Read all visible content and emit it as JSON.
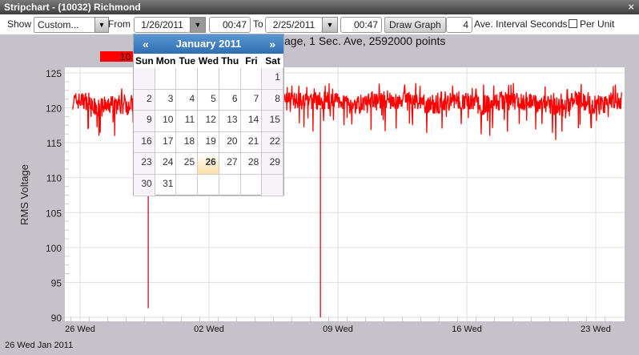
{
  "window": {
    "title": "Stripchart - (10032) Richmond",
    "close": "×"
  },
  "toolbar": {
    "show_label": "Show",
    "show_value": "Custom...",
    "from_label": "From",
    "from_date": "1/26/2011",
    "from_time": "00:47",
    "to_label": "To",
    "to_date": "2/25/2011",
    "to_time": "00:47",
    "draw_button": "Draw Graph",
    "interval_value": "4",
    "interval_label": "Ave. Interval Seconds",
    "per_unit_label": "Per Unit",
    "per_unit_checked": false
  },
  "calendar": {
    "prev": "«",
    "next": "»",
    "month": "January 2011",
    "days_of_week": [
      "Sun",
      "Mon",
      "Tue",
      "Wed",
      "Thu",
      "Fri",
      "Sat"
    ],
    "first_weekday": 6,
    "days_in_month": 31,
    "selected_day": 26
  },
  "chart_data": {
    "type": "line",
    "title": "age, 1 Sec. Ave, 2592000 points",
    "legend": [
      {
        "label": "10",
        "color": "#ff0000"
      }
    ],
    "ylabel": "RMS Voltage",
    "ylim": [
      90,
      126
    ],
    "yticks": [
      90,
      95,
      100,
      105,
      110,
      115,
      120,
      125
    ],
    "xlabel": "26 Wed Jan 2011",
    "xunit": "days since 26 Jan 2011",
    "xlim": [
      -0.8,
      29.6
    ],
    "xticks": [
      {
        "x": 0,
        "label": "26 Wed"
      },
      {
        "x": 7,
        "label": "02 Wed"
      },
      {
        "x": 14,
        "label": "09 Wed"
      },
      {
        "x": 21,
        "label": "16 Wed"
      },
      {
        "x": 28,
        "label": "23 Wed"
      }
    ],
    "series": [
      {
        "name": "10",
        "color": "#ff0000",
        "x_start": -0.4,
        "x_end": 29.4,
        "daily_mean": [
          121,
          120,
          120.5,
          120.5,
          120,
          121,
          121,
          120.5,
          121,
          120.5,
          121,
          120.8,
          121,
          121,
          121,
          120.5,
          121,
          121,
          121,
          120.5,
          121,
          121,
          120.5,
          121,
          121,
          120.5,
          120,
          121,
          120.5,
          121
        ],
        "spread": [
          1.8,
          2,
          2.2,
          2,
          2,
          1.8,
          1.8,
          2,
          1.8,
          2,
          2,
          2,
          1.8,
          2,
          1.8,
          2,
          2,
          1.8,
          2,
          2,
          2,
          1.8,
          2.2,
          2,
          2,
          2,
          2.2,
          2,
          2,
          1.8
        ]
      }
    ],
    "spikes": [
      {
        "x": 3.7,
        "min": 91.3
      },
      {
        "x": 13.05,
        "min": 90
      }
    ]
  }
}
